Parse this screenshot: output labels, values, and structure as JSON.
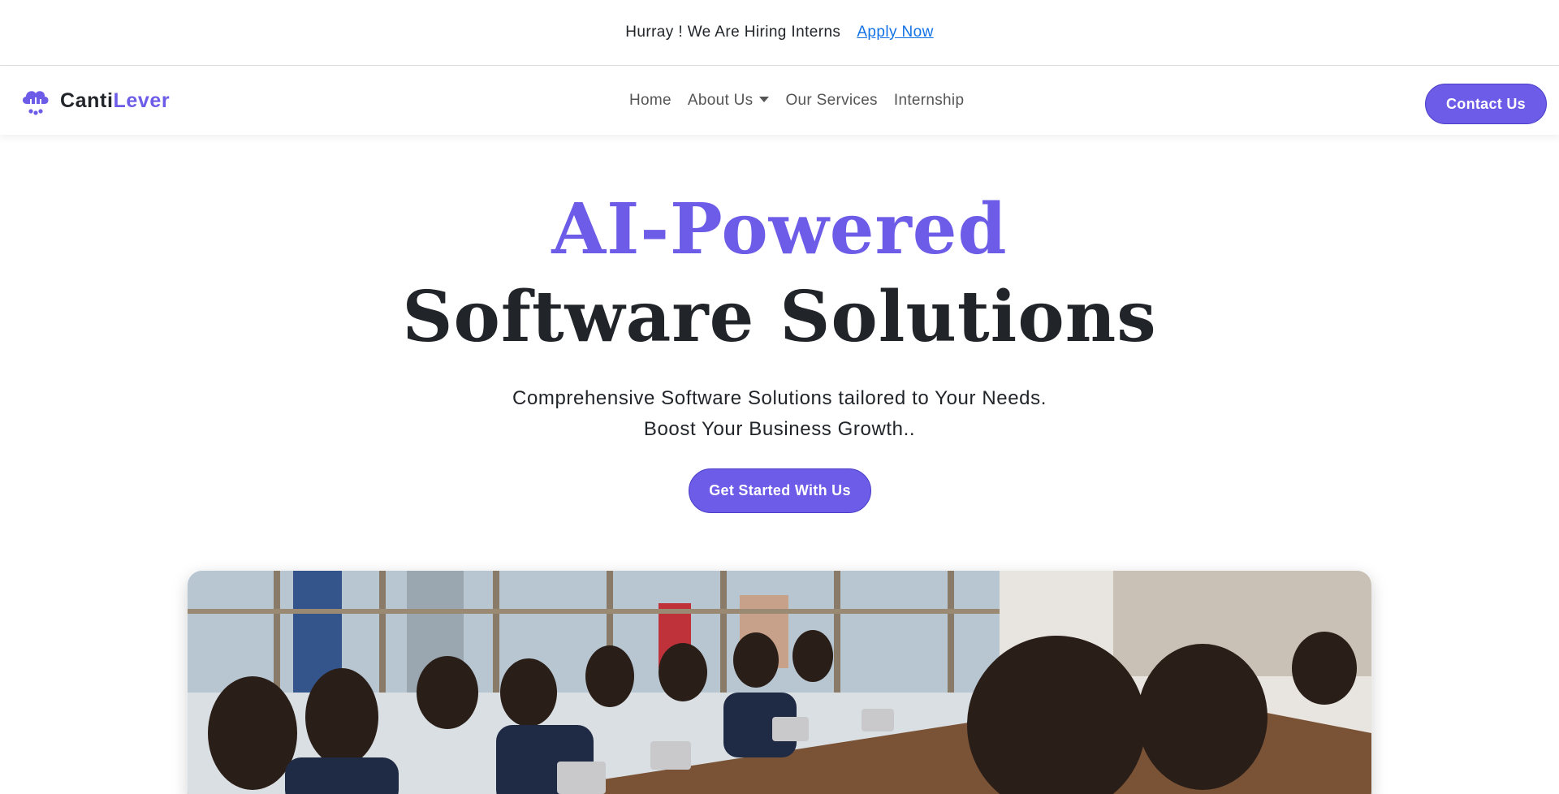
{
  "announcement": {
    "text": "Hurray ! We Are Hiring Interns",
    "link_label": "Apply Now"
  },
  "navbar": {
    "brand_first": "Canti",
    "brand_second": "Lever",
    "links": [
      {
        "label": "Home"
      },
      {
        "label": "About Us",
        "dropdown": true
      },
      {
        "label": "Our Services"
      },
      {
        "label": "Internship"
      }
    ],
    "contact_label": "Contact Us"
  },
  "hero": {
    "title_line1": "AI-Powered",
    "title_line2": "Software Solutions",
    "subtitle_line1": "Comprehensive Software Solutions tailored to Your Needs.",
    "subtitle_line2": "Boost Your Business Growth..",
    "cta_label": "Get Started With Us"
  },
  "colors": {
    "accent": "#6c5ce7",
    "link": "#1473e6",
    "text": "#212529"
  },
  "icons": {
    "brand": "cloud-network-icon",
    "dropdown": "caret-down-icon"
  }
}
